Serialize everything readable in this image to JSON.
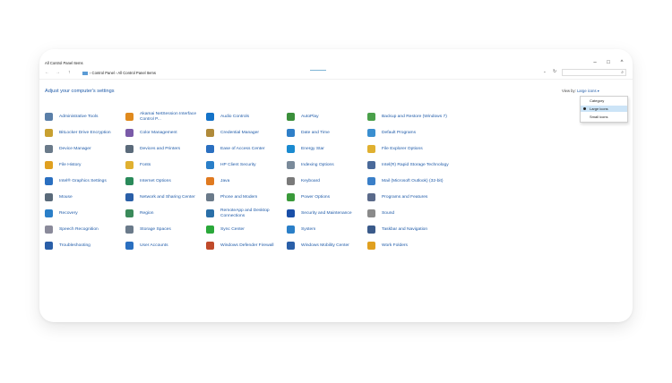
{
  "window": {
    "title": "All Control Panel Items",
    "controls": {
      "minimize": "–",
      "maximize": "□",
      "close": "^"
    }
  },
  "address_bar": {
    "back": "←",
    "forward": "→",
    "up": "↑",
    "breadcrumb": "› Control Panel › All Control Panel Items",
    "dropdown": "⌄",
    "refresh": "↻",
    "search_icon": "⌕",
    "search_placeholder": ""
  },
  "heading": "Adjust your computer's settings",
  "view_by": {
    "label": "View by:",
    "selected": "Large icons ▾",
    "options": [
      {
        "label": "Category",
        "selected": false
      },
      {
        "label": "Large icons",
        "selected": true
      },
      {
        "label": "Small icons",
        "selected": false
      }
    ]
  },
  "items": [
    [
      "Administrative Tools",
      "Akamai NetSession Interface Control P...",
      "Audio Controls",
      "AutoPlay",
      "Backup and Restore (Windows 7)"
    ],
    [
      "BitLocker Drive Encryption",
      "Color Management",
      "Credential Manager",
      "Date and Time",
      "Default Programs"
    ],
    [
      "Device Manager",
      "Devices and Printers",
      "Ease of Access Center",
      "Energy Star",
      "File Explorer Options"
    ],
    [
      "File History",
      "Fonts",
      "HP Client Security",
      "Indexing Options",
      "Intel(R) Rapid Storage Technology"
    ],
    [
      "Intel® Graphics Settings",
      "Internet Options",
      "Java",
      "Keyboard",
      "Mail (Microsoft Outlook) (32-bit)"
    ],
    [
      "Mouse",
      "Network and Sharing Center",
      "Phone and Modem",
      "Power Options",
      "Programs and Features"
    ],
    [
      "Recovery",
      "Region",
      "RemoteApp and Desktop Connections",
      "Security and Maintenance",
      "Sound"
    ],
    [
      "Speech Recognition",
      "Storage Spaces",
      "Sync Center",
      "System",
      "Taskbar and Navigation"
    ],
    [
      "Troubleshooting",
      "User Accounts",
      "Windows Defender Firewall",
      "Windows Mobility Center",
      "Work Folders"
    ]
  ],
  "icon_names": [
    [
      "tools-icon",
      "akamai-icon",
      "hp-audio-icon",
      "autoplay-icon",
      "backup-icon"
    ],
    [
      "bitlocker-key-icon",
      "color-management-icon",
      "credential-vault-icon",
      "calendar-clock-icon",
      "default-programs-icon"
    ],
    [
      "device-manager-icon",
      "printer-icon",
      "ease-of-access-icon",
      "energy-star-icon",
      "folder-options-icon"
    ],
    [
      "file-history-icon",
      "fonts-icon",
      "hp-shield-icon",
      "indexing-icon",
      "intel-storage-icon"
    ],
    [
      "intel-graphics-icon",
      "globe-icon",
      "java-icon",
      "keyboard-icon",
      "mail-icon"
    ],
    [
      "mouse-icon",
      "network-icon",
      "phone-modem-icon",
      "power-icon",
      "programs-icon"
    ],
    [
      "recovery-icon",
      "region-globe-icon",
      "remote-desktop-icon",
      "security-flag-icon",
      "speaker-icon"
    ],
    [
      "microphone-icon",
      "storage-spaces-icon",
      "sync-icon",
      "system-icon",
      "taskbar-icon"
    ],
    [
      "troubleshooting-icon",
      "user-accounts-icon",
      "firewall-icon",
      "mobility-icon",
      "work-folders-icon"
    ]
  ],
  "icon_colors": [
    [
      "#5a7fa8",
      "#e08a1e",
      "#1473c8",
      "#3b8f3b",
      "#4aa04a"
    ],
    [
      "#c8a030",
      "#7a5aa8",
      "#b08a3a",
      "#2f7fc8",
      "#3a8fd0"
    ],
    [
      "#6a7a8a",
      "#5a6a7a",
      "#2a6fc0",
      "#1a8ad0",
      "#e0b030"
    ],
    [
      "#e0a020",
      "#e0b030",
      "#2a7fc8",
      "#7a8a9a",
      "#4a6a9a"
    ],
    [
      "#2a6fc0",
      "#2a8a5a",
      "#e07a20",
      "#7a7a7a",
      "#3a7fc8"
    ],
    [
      "#5a6a7a",
      "#2a5fa8",
      "#6a7a8a",
      "#3a9a3a",
      "#5a6a8a"
    ],
    [
      "#2a7fc8",
      "#3a8a5a",
      "#2a6fa8",
      "#1a4fa8",
      "#8a8a8a"
    ],
    [
      "#8a8a9a",
      "#6a7a8a",
      "#2aa83a",
      "#2a7fc8",
      "#3a5a8a"
    ],
    [
      "#2a5fa8",
      "#2a6fc0",
      "#c04a2a",
      "#2a5fa8",
      "#e0a020"
    ]
  ]
}
